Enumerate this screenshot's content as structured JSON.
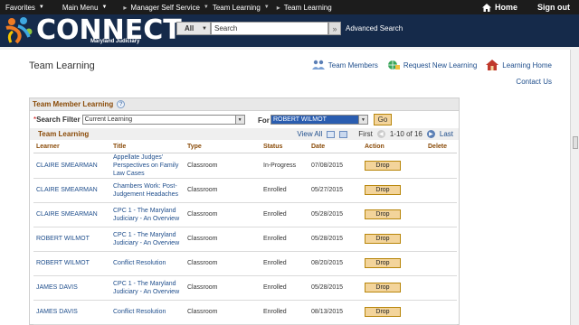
{
  "topnav": {
    "favorites": "Favorites",
    "main_menu": "Main Menu",
    "breadcrumbs": [
      "Manager Self Service",
      "Team Learning",
      "Team Learning"
    ],
    "home": "Home",
    "sign_out": "Sign out"
  },
  "banner": {
    "logo_text": "CONNECT",
    "logo_subtitle": "Maryland Judiciary",
    "search_scope": "All",
    "search_placeholder": "Search",
    "search_go": "»",
    "advanced_search": "Advanced Search"
  },
  "page": {
    "title": "Team Learning",
    "links": {
      "team_members": "Team Members",
      "request_new_learning": "Request New Learning",
      "learning_home": "Learning Home",
      "contact_us": "Contact Us"
    }
  },
  "panel": {
    "title": "Team Member Learning",
    "help": "?",
    "search_filter_label": "Search Filter",
    "search_filter_value": "Current Learning",
    "for_label": "For",
    "for_value": "ROBERT WILMOT",
    "go_label": "Go"
  },
  "grid": {
    "title": "Team Learning",
    "view_all": "View All",
    "first": "First",
    "range": "1-10 of 16",
    "last": "Last",
    "columns": [
      "Learner",
      "Title",
      "Type",
      "Status",
      "Date",
      "Action",
      "Delete"
    ],
    "rows": [
      {
        "learner": "CLAIRE SMEARMAN",
        "title": "Appellate Judges' Perspectives on Family Law Cases",
        "type": "Classroom",
        "status": "In-Progress",
        "date": "07/08/2015",
        "action": "Drop"
      },
      {
        "learner": "CLAIRE SMEARMAN",
        "title": "Chambers Work: Post-Judgement Headaches",
        "type": "Classroom",
        "status": "Enrolled",
        "date": "05/27/2015",
        "action": "Drop"
      },
      {
        "learner": "CLAIRE SMEARMAN",
        "title": "CPC 1 - The Maryland Judiciary - An Overview",
        "type": "Classroom",
        "status": "Enrolled",
        "date": "05/28/2015",
        "action": "Drop"
      },
      {
        "learner": "ROBERT WILMOT",
        "title": "CPC 1 - The Maryland Judiciary - An Overview",
        "type": "Classroom",
        "status": "Enrolled",
        "date": "05/28/2015",
        "action": "Drop"
      },
      {
        "learner": "ROBERT WILMOT",
        "title": "Conflict Resolution",
        "type": "Classroom",
        "status": "Enrolled",
        "date": "08/20/2015",
        "action": "Drop"
      },
      {
        "learner": "JAMES DAVIS",
        "title": "CPC 1 - The Maryland Judiciary - An Overview",
        "type": "Classroom",
        "status": "Enrolled",
        "date": "05/28/2015",
        "action": "Drop"
      },
      {
        "learner": "JAMES DAVIS",
        "title": "Conflict Resolution",
        "type": "Classroom",
        "status": "Enrolled",
        "date": "08/13/2015",
        "action": "Drop"
      }
    ]
  },
  "colors": {
    "topnav_bg": "#1c1c1c",
    "banner_bg": "#152a4a",
    "link": "#1f4e8c",
    "section_title": "#8a4b08",
    "button_bg": "#f3d49b"
  }
}
